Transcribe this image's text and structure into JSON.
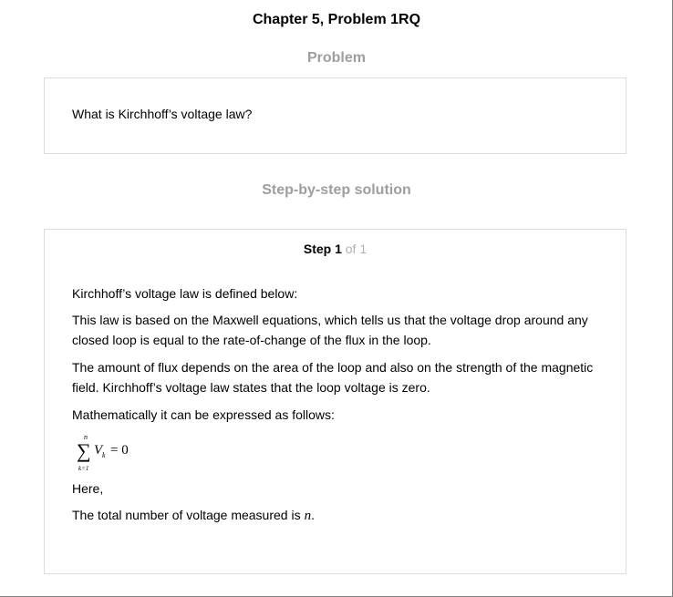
{
  "header": {
    "chapter_title": "Chapter 5, Problem 1RQ"
  },
  "problem": {
    "heading": "Problem",
    "text": "What is Kirchhoff’s voltage law?"
  },
  "solution": {
    "heading": "Step-by-step solution",
    "step_label": "Step 1",
    "step_total": "of 1",
    "paragraphs": [
      "Kirchhoff’s voltage law is defined below:",
      "This law is based on the Maxwell equations, which tells us that the voltage drop around any closed loop is equal to the rate-of-change of the flux in the loop.",
      "The amount of flux depends on the area of the loop and also on the strength of the magnetic field. Kirchhoff’s voltage law states that the loop voltage is zero.",
      "Mathematically it can be expressed as follows:",
      "Here,",
      "The total number of voltage measured is"
    ],
    "formula": {
      "sigma": "∑",
      "upper_limit": "n",
      "lower_limit": "k=1",
      "term": "V",
      "subscript": "k",
      "rhs": "= 0"
    },
    "variable_n": "n",
    "period": "."
  }
}
